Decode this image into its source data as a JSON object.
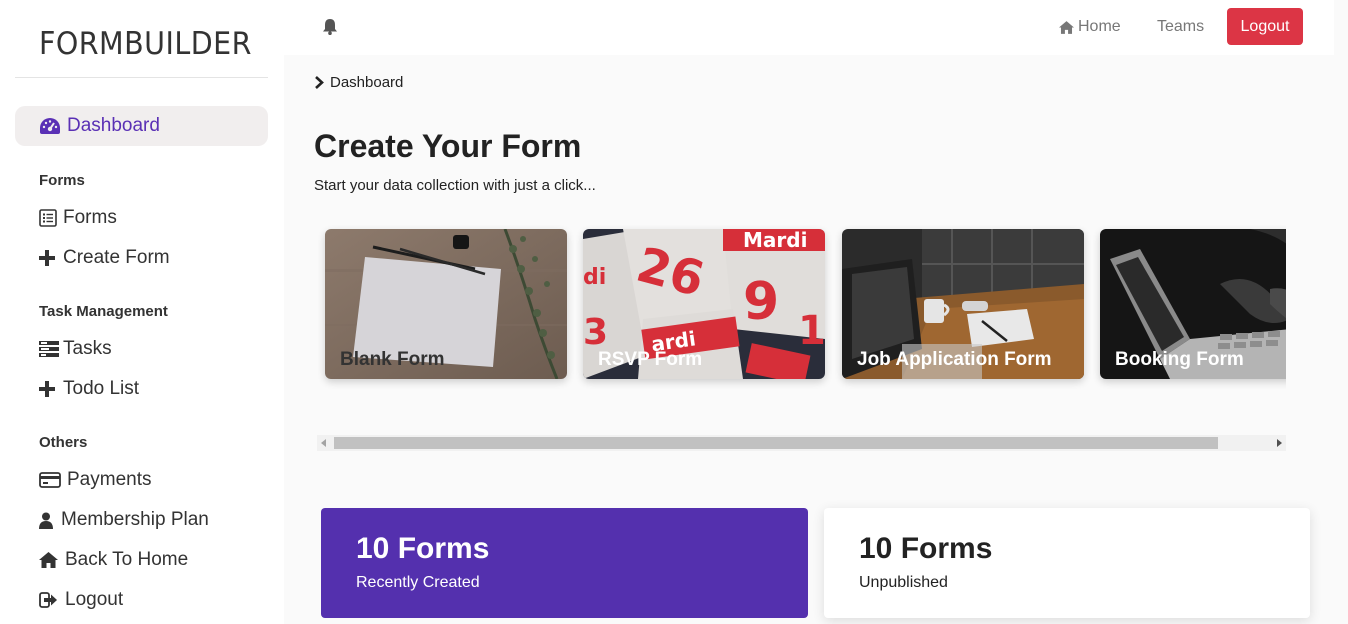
{
  "brand": "FORMBUILDER",
  "sidebar": {
    "active": "Dashboard",
    "sections": [
      {
        "title": "Forms",
        "items": [
          {
            "label": "Forms",
            "icon": "list-alt-icon"
          },
          {
            "label": "Create Form",
            "icon": "plus-icon"
          }
        ]
      },
      {
        "title": "Task Management",
        "items": [
          {
            "label": "Tasks",
            "icon": "tasks-icon"
          },
          {
            "label": "Todo List",
            "icon": "plus-icon"
          }
        ]
      },
      {
        "title": "Others",
        "items": [
          {
            "label": "Payments",
            "icon": "credit-card-icon"
          },
          {
            "label": "Membership Plan",
            "icon": "user-icon"
          },
          {
            "label": "Back To Home",
            "icon": "home-icon"
          },
          {
            "label": "Logout",
            "icon": "sign-out-icon"
          }
        ]
      }
    ]
  },
  "topbar": {
    "home": "Home",
    "teams": "Teams",
    "logout": "Logout"
  },
  "breadcrumb": "Dashboard",
  "hero": {
    "title": "Create Your Form",
    "subtitle": "Start your data collection with just a click..."
  },
  "templates": [
    {
      "label": "Blank Form"
    },
    {
      "label": "RSVP Form"
    },
    {
      "label": "Job Application Form"
    },
    {
      "label": "Booking Form"
    }
  ],
  "stats": [
    {
      "value": "10 Forms",
      "caption": "Recently Created"
    },
    {
      "value": "10 Forms",
      "caption": "Unpublished"
    }
  ],
  "colors": {
    "accent": "#5430ae",
    "danger": "#dc3545",
    "active_bg": "#f1eeee"
  }
}
